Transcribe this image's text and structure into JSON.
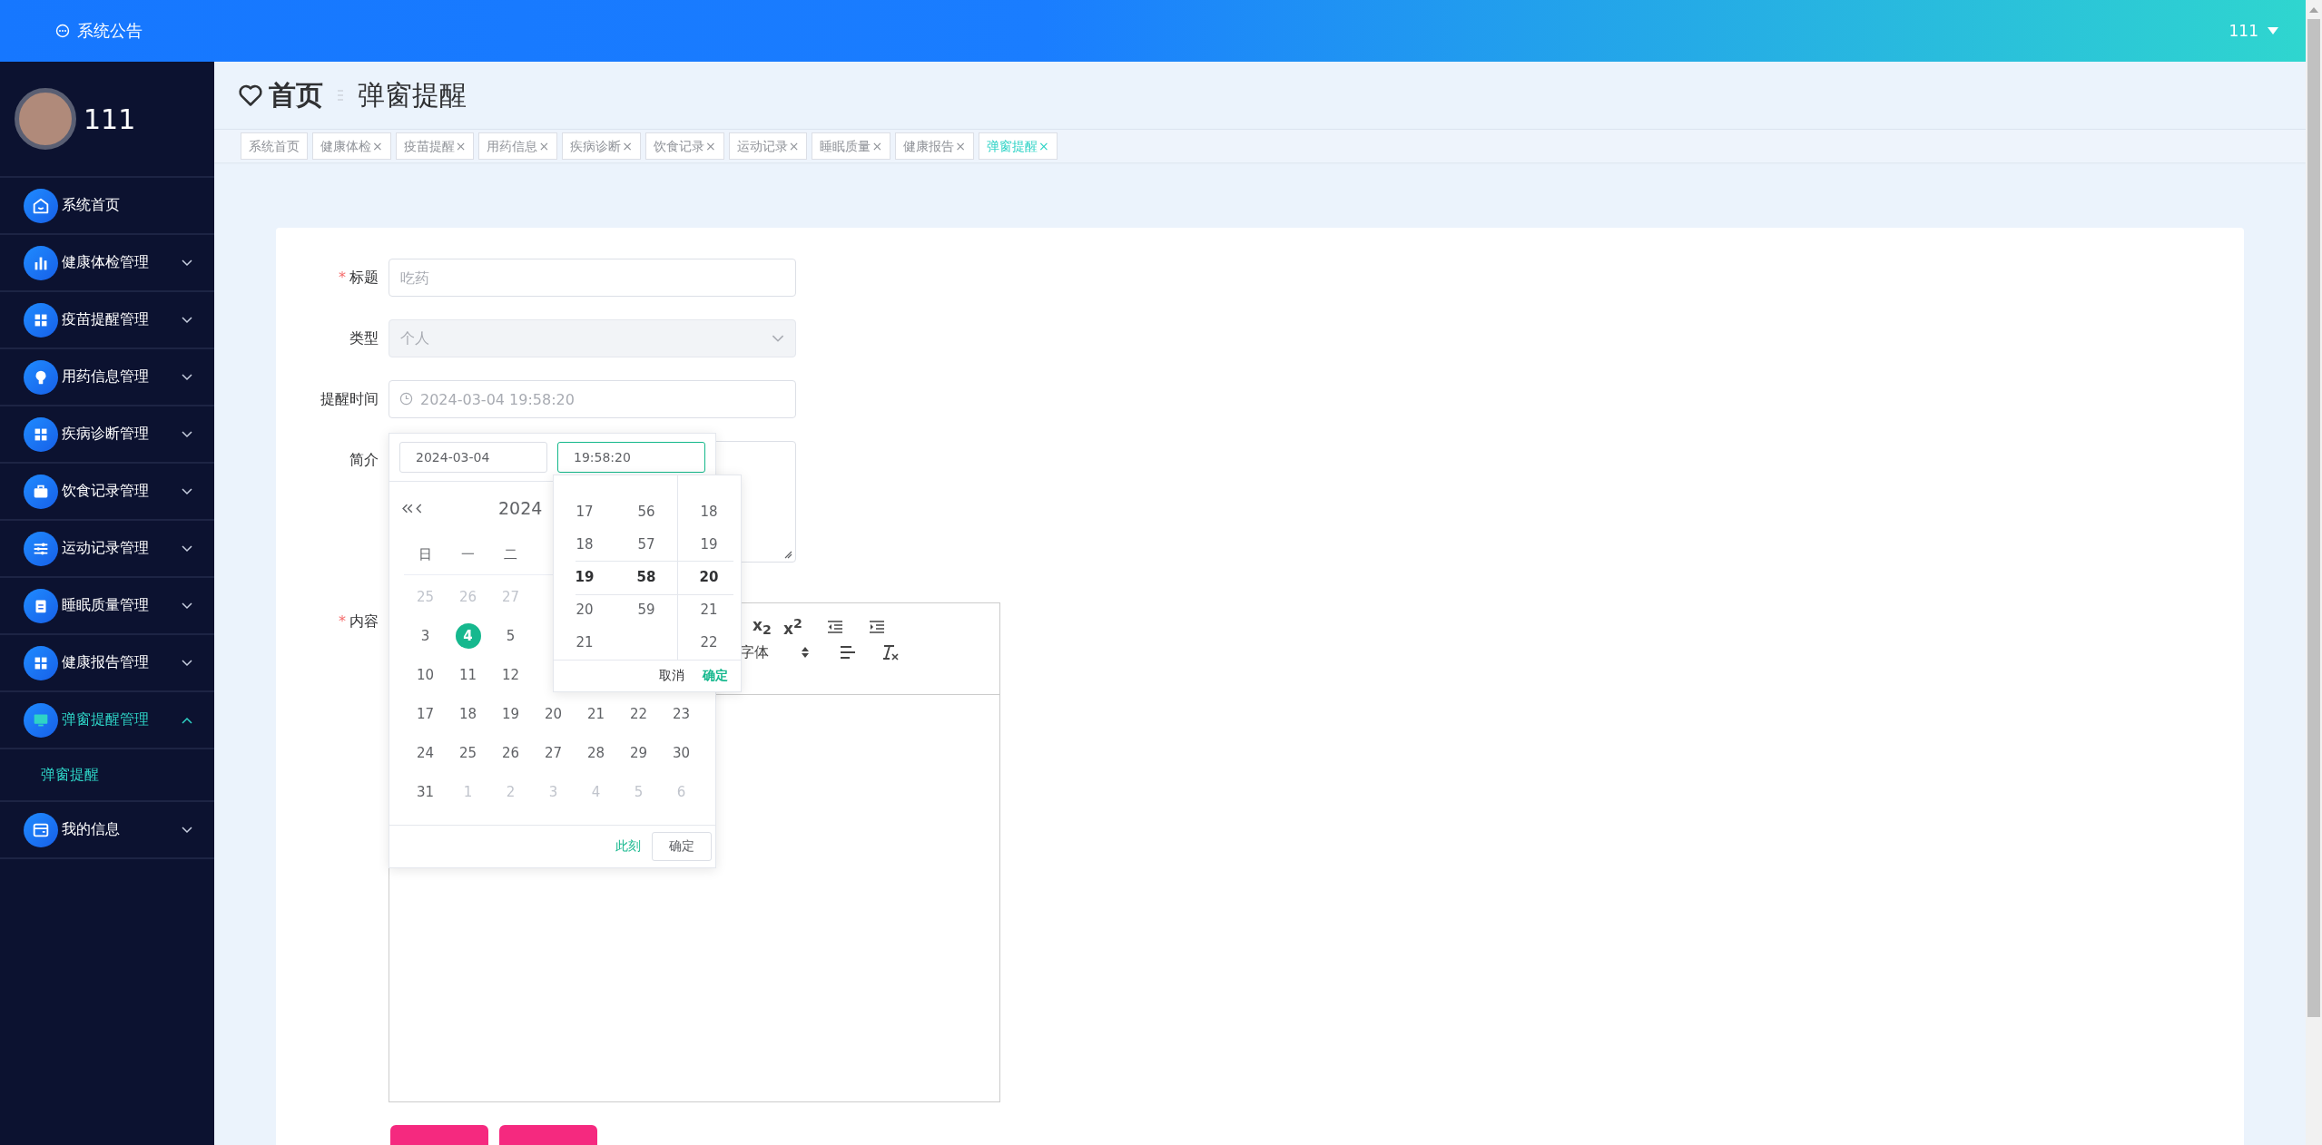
{
  "header": {
    "notice": "系统公告",
    "user": "111"
  },
  "sidebar": {
    "username": "111",
    "items": [
      {
        "label": "系统首页",
        "kind": "link",
        "selected": false
      },
      {
        "label": "健康体检管理",
        "kind": "submenu",
        "selected": false,
        "expanded": false
      },
      {
        "label": "疫苗提醒管理",
        "kind": "submenu",
        "selected": false,
        "expanded": false
      },
      {
        "label": "用药信息管理",
        "kind": "submenu",
        "selected": false,
        "expanded": false
      },
      {
        "label": "疾病诊断管理",
        "kind": "submenu",
        "selected": false,
        "expanded": false
      },
      {
        "label": "饮食记录管理",
        "kind": "submenu",
        "selected": false,
        "expanded": false
      },
      {
        "label": "运动记录管理",
        "kind": "submenu",
        "selected": false,
        "expanded": false
      },
      {
        "label": "睡眠质量管理",
        "kind": "submenu",
        "selected": false,
        "expanded": false
      },
      {
        "label": "健康报告管理",
        "kind": "submenu",
        "selected": false,
        "expanded": false
      },
      {
        "label": "弹窗提醒管理",
        "kind": "submenu",
        "selected": true,
        "expanded": true,
        "children": [
          {
            "label": "弹窗提醒",
            "selected": true
          }
        ]
      },
      {
        "label": "我的信息",
        "kind": "submenu",
        "selected": false,
        "expanded": false
      }
    ]
  },
  "breadcrumb": {
    "home": "首页",
    "current": "弹窗提醒"
  },
  "tabs": [
    {
      "label": "系统首页",
      "selected": false
    },
    {
      "label": "健康体检",
      "close": "×",
      "selected": false
    },
    {
      "label": "疫苗提醒",
      "close": "×",
      "selected": false
    },
    {
      "label": "用药信息",
      "close": "×",
      "selected": false
    },
    {
      "label": "疾病诊断",
      "close": "×",
      "selected": false
    },
    {
      "label": "饮食记录",
      "close": "×",
      "selected": false
    },
    {
      "label": "运动记录",
      "close": "×",
      "selected": false
    },
    {
      "label": "睡眠质量",
      "close": "×",
      "selected": false
    },
    {
      "label": "健康报告",
      "close": "×",
      "selected": false
    },
    {
      "label": "弹窗提醒",
      "close": "×",
      "selected": true
    }
  ],
  "form": {
    "fields": [
      {
        "kind": "input",
        "label": "标题",
        "required_mark": "*",
        "placeholder": "吃药"
      },
      {
        "kind": "select",
        "label": "类型",
        "value": "个人",
        "disabled": true
      },
      {
        "kind": "datetime",
        "label": "提醒时间",
        "placeholder": "2024-03-04 19:58:20"
      },
      {
        "kind": "textarea",
        "label": "简介"
      },
      {
        "kind": "editor",
        "label": "内容",
        "required_mark": "*"
      }
    ]
  },
  "editor": {
    "toolbar_rows": [
      [
        {
          "kind": "glyph",
          "text": "x$_{2}$"
        },
        {
          "kind": "glyph",
          "text": "x$^{2}$"
        },
        {
          "kind": "outdent"
        },
        {
          "kind": "indent"
        }
      ],
      [
        {
          "kind": "picker",
          "text": "字体"
        },
        {
          "kind": "align"
        },
        {
          "kind": "clean"
        }
      ]
    ]
  },
  "buttons": [
    {
      "kind": "primary"
    },
    {
      "kind": "primary"
    }
  ],
  "date_picker": {
    "date_input": "2024-03-04",
    "time_input": "19:58:20",
    "header": "2024",
    "weekdays": [
      "日",
      "一",
      "二"
    ],
    "weeks": [
      [
        {
          "day": "25",
          "muted": true,
          "selected": false
        },
        {
          "day": "26",
          "muted": true,
          "selected": false
        },
        {
          "day": "27",
          "muted": true,
          "selected": false
        }
      ],
      [
        {
          "day": "3",
          "muted": false,
          "selected": false
        },
        {
          "day": "4",
          "muted": false,
          "selected": true
        },
        {
          "day": "5",
          "muted": false,
          "selected": false
        }
      ],
      [
        {
          "day": "10",
          "muted": false,
          "selected": false
        },
        {
          "day": "11",
          "muted": false,
          "selected": false
        },
        {
          "day": "12",
          "muted": false,
          "selected": false
        }
      ],
      [
        {
          "day": "17",
          "muted": false,
          "selected": false
        },
        {
          "day": "18",
          "muted": false,
          "selected": false
        },
        {
          "day": "19",
          "muted": false,
          "selected": false
        },
        {
          "day": "20",
          "muted": false,
          "selected": false
        },
        {
          "day": "21",
          "muted": false,
          "selected": false
        },
        {
          "day": "22",
          "muted": false,
          "selected": false
        },
        {
          "day": "23",
          "muted": false,
          "selected": false
        }
      ],
      [
        {
          "day": "24",
          "muted": false,
          "selected": false
        },
        {
          "day": "25",
          "muted": false,
          "selected": false
        },
        {
          "day": "26",
          "muted": false,
          "selected": false
        },
        {
          "day": "27",
          "muted": false,
          "selected": false
        },
        {
          "day": "28",
          "muted": false,
          "selected": false
        },
        {
          "day": "29",
          "muted": false,
          "selected": false
        },
        {
          "day": "30",
          "muted": false,
          "selected": false
        }
      ],
      [
        {
          "day": "31",
          "muted": false,
          "selected": false
        },
        {
          "day": "1",
          "muted": true,
          "selected": false
        },
        {
          "day": "2",
          "muted": true,
          "selected": false
        },
        {
          "day": "3",
          "muted": true,
          "selected": false
        },
        {
          "day": "4",
          "muted": true,
          "selected": false
        },
        {
          "day": "5",
          "muted": true,
          "selected": false
        },
        {
          "day": "6",
          "muted": true,
          "selected": false
        }
      ]
    ],
    "now": "此刻",
    "confirm": "确定"
  },
  "time_panel": {
    "columns": [
      [
        {
          "text": "17",
          "selected": false
        },
        {
          "text": "18",
          "selected": false
        },
        {
          "text": "19",
          "selected": true
        },
        {
          "text": "20",
          "selected": false
        },
        {
          "text": "21",
          "selected": false
        }
      ],
      [
        {
          "text": "56",
          "selected": false
        },
        {
          "text": "57",
          "selected": false
        },
        {
          "text": "58",
          "selected": true
        },
        {
          "text": "59",
          "selected": false
        }
      ],
      [
        {
          "text": "18",
          "selected": false
        },
        {
          "text": "19",
          "selected": false
        },
        {
          "text": "20",
          "selected": true
        },
        {
          "text": "21",
          "selected": false
        },
        {
          "text": "22",
          "selected": false
        }
      ]
    ],
    "cancel": "取消",
    "confirm": "确定"
  }
}
